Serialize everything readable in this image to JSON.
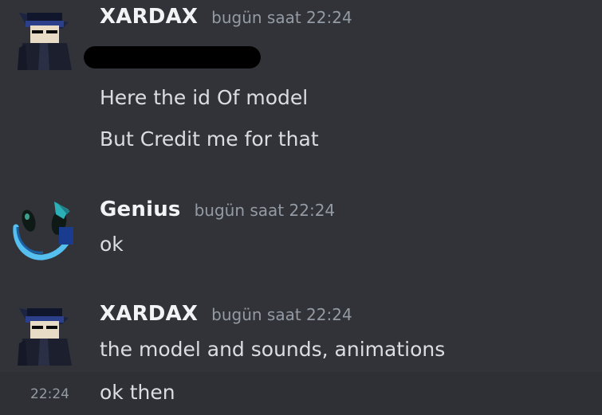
{
  "messages": [
    {
      "username": "XARDAX",
      "timestamp": "bugün saat 22:24",
      "lines": [
        "Here the id Of model",
        "But Credit me for that"
      ]
    },
    {
      "username": "Genius",
      "timestamp": "bugün saat 22:24",
      "lines": [
        "ok"
      ]
    },
    {
      "username": "XARDAX",
      "timestamp": "bugün saat 22:24",
      "lines": [
        "the model and sounds, animations"
      ]
    }
  ],
  "followup": {
    "hover_time": "22:24",
    "text": "ok then"
  },
  "colors": {
    "background": "#313338",
    "username": "#f2f3f5",
    "text": "#dbdee1",
    "muted": "#949ba4"
  }
}
